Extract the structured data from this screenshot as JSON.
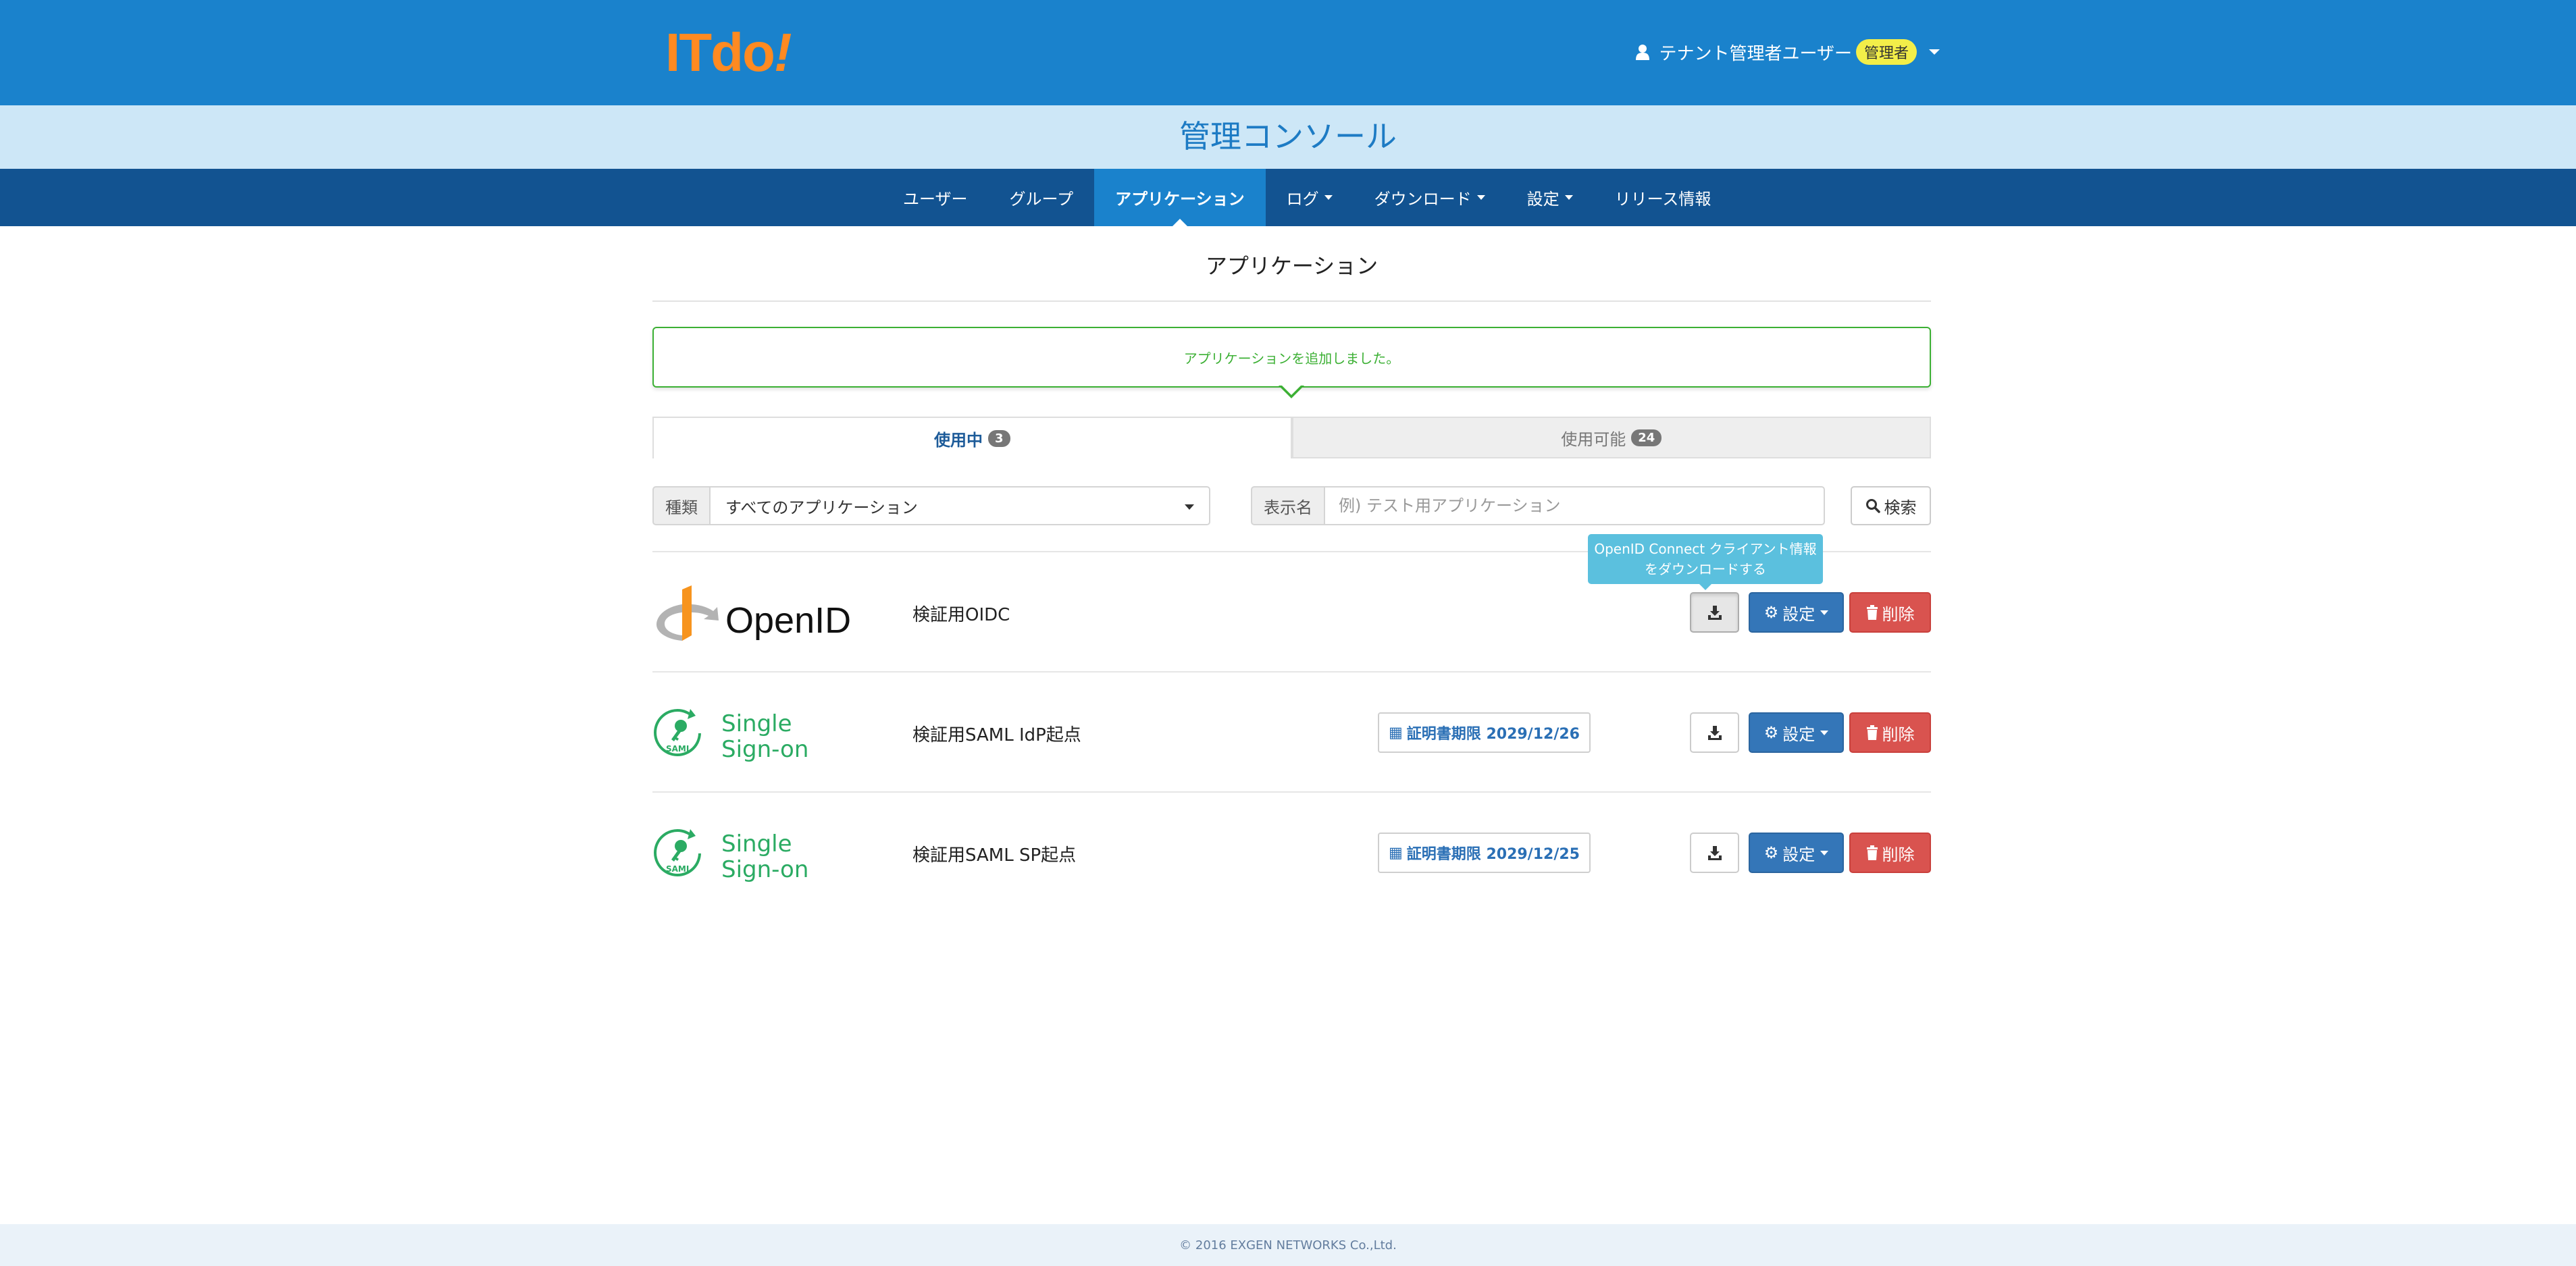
{
  "brand": {
    "logo_text": "ITdo",
    "logo_bang": "!",
    "logo_color": "#ff8a21"
  },
  "header": {
    "user_name": "テナント管理者ユーザー",
    "role_badge": "管理者",
    "user_icon": "user-icon"
  },
  "console": {
    "title": "管理コンソール"
  },
  "nav": {
    "items": [
      {
        "label": "ユーザー",
        "active": false,
        "dropdown": false
      },
      {
        "label": "グループ",
        "active": false,
        "dropdown": false
      },
      {
        "label": "アプリケーション",
        "active": true,
        "dropdown": false
      },
      {
        "label": "ログ",
        "active": false,
        "dropdown": true
      },
      {
        "label": "ダウンロード",
        "active": false,
        "dropdown": true
      },
      {
        "label": "設定",
        "active": false,
        "dropdown": true
      },
      {
        "label": "リリース情報",
        "active": false,
        "dropdown": false
      }
    ]
  },
  "page": {
    "title": "アプリケーション"
  },
  "alert": {
    "message": "アプリケーションを追加しました。"
  },
  "tabs": [
    {
      "label": "使用中",
      "count": "3",
      "active": true
    },
    {
      "label": "使用可能",
      "count": "24",
      "active": false
    }
  ],
  "filter": {
    "type_label": "種類",
    "type_value": "すべてのアプリケーション",
    "name_label": "表示名",
    "name_value": "",
    "name_placeholder": "例) テスト用アプリケーション",
    "search_label": "検索",
    "search_icon": "search-icon"
  },
  "tooltip": {
    "line1": "OpenID Connect クライアント情報",
    "line2": "をダウンロードする"
  },
  "apps": [
    {
      "logo": "OpenID",
      "logo_type": "openid",
      "name": "検証用OIDC",
      "cert": "",
      "download_icon": "download-icon",
      "settings_label": "設定",
      "delete_label": "削除"
    },
    {
      "logo": "Single Sign-on",
      "logo_type": "saml",
      "logo_line1": "Single",
      "logo_line2": "Sign-on",
      "logo_tag": "SAML",
      "name": "検証用SAML IdP起点",
      "cert": "証明書期限 2029/12/26",
      "download_icon": "download-icon",
      "settings_label": "設定",
      "delete_label": "削除"
    },
    {
      "logo": "Single Sign-on",
      "logo_type": "saml",
      "logo_line1": "Single",
      "logo_line2": "Sign-on",
      "logo_tag": "SAML",
      "name": "検証用SAML SP起点",
      "cert": "証明書期限 2029/12/25",
      "download_icon": "download-icon",
      "settings_label": "設定",
      "delete_label": "削除"
    }
  ],
  "footer": {
    "copyright": "© 2016 EXGEN NETWORKS Co.,Ltd."
  },
  "colors": {
    "header_blue": "#1a82cc",
    "nav_blue": "#125391",
    "band_blue": "#cde7f7",
    "success_green": "#3cb034",
    "primary_btn": "#3476b8",
    "danger_btn": "#d9534f",
    "tooltip_bg": "#5bc0de",
    "saml_green": "#2bab63"
  }
}
